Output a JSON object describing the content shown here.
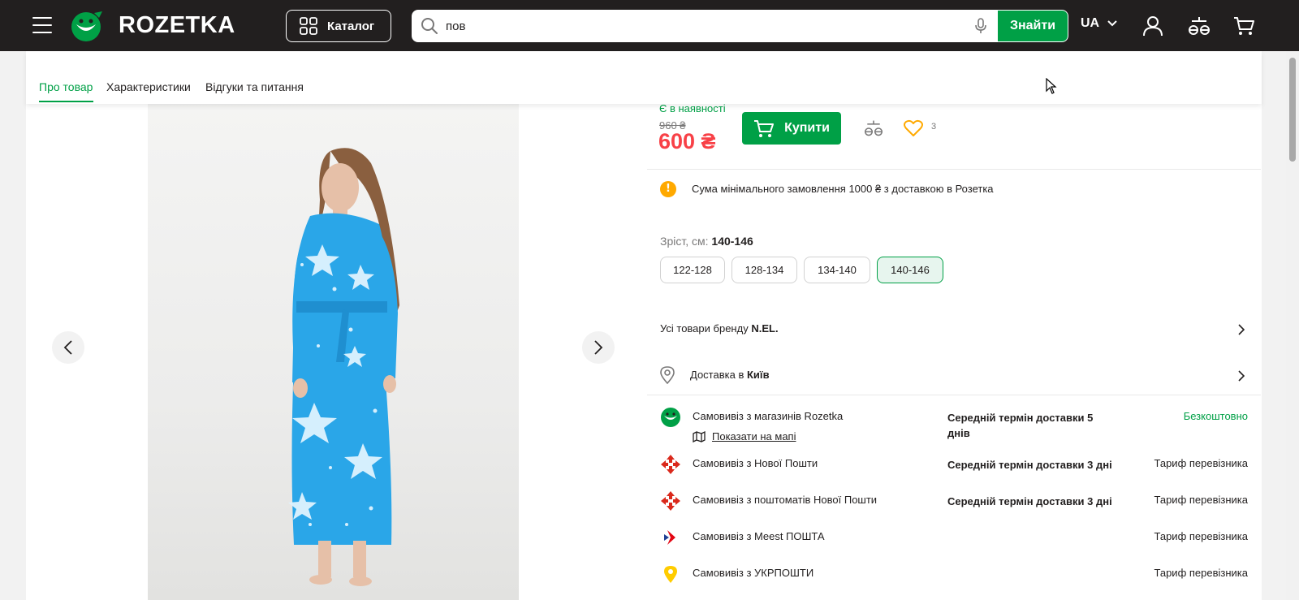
{
  "header": {
    "logo_text": "ROZETKA",
    "catalog_label": "Каталог",
    "search": {
      "value": "пов",
      "button_label": "Знайти"
    },
    "language": "UA"
  },
  "tabs": [
    {
      "label": "Про товар",
      "active": true
    },
    {
      "label": "Характеристики",
      "active": false
    },
    {
      "label": "Відгуки та питання",
      "active": false
    }
  ],
  "product": {
    "stock_status": "Є в наявності",
    "old_price": "960 ₴",
    "price": "600 ₴",
    "buy_label": "Купити",
    "favorites_count": "3",
    "min_order_notice": "Сума мінімального замовлення 1000 ₴ з доставкою в Розетка"
  },
  "sizes": {
    "label": "Зріст, см:",
    "selected": "140-146",
    "options": [
      "122-128",
      "128-134",
      "134-140",
      "140-146"
    ]
  },
  "brand": {
    "prefix": "Усі товари бренду",
    "name": "N.EL."
  },
  "delivery": {
    "prefix": "Доставка в",
    "city": "Київ",
    "options": [
      {
        "name": "Самовивіз з магазинів Rozetka",
        "term": "Середній термін доставки 5 днів",
        "price": "Безкоштовно",
        "map_link": "Показати на мапі"
      },
      {
        "name": "Самовивіз з Нової Пошти",
        "term": "Середній термін доставки 3 дні",
        "price": "Тариф перевізника"
      },
      {
        "name": "Самовивіз з поштоматів Нової Пошти",
        "term": "Середній термін доставки 3 дні",
        "price": "Тариф перевізника"
      },
      {
        "name": "Самовивіз з Meest ПОШТА",
        "term": "",
        "price": "Тариф перевізника"
      },
      {
        "name": "Самовивіз з УКРПОШТИ",
        "term": "",
        "price": "Тариф перевізника"
      }
    ]
  },
  "colors": {
    "brand_green": "#00a046",
    "price_red": "#f84147",
    "header_dark": "#221f1f",
    "robe_blue": "#2aa6e8"
  }
}
